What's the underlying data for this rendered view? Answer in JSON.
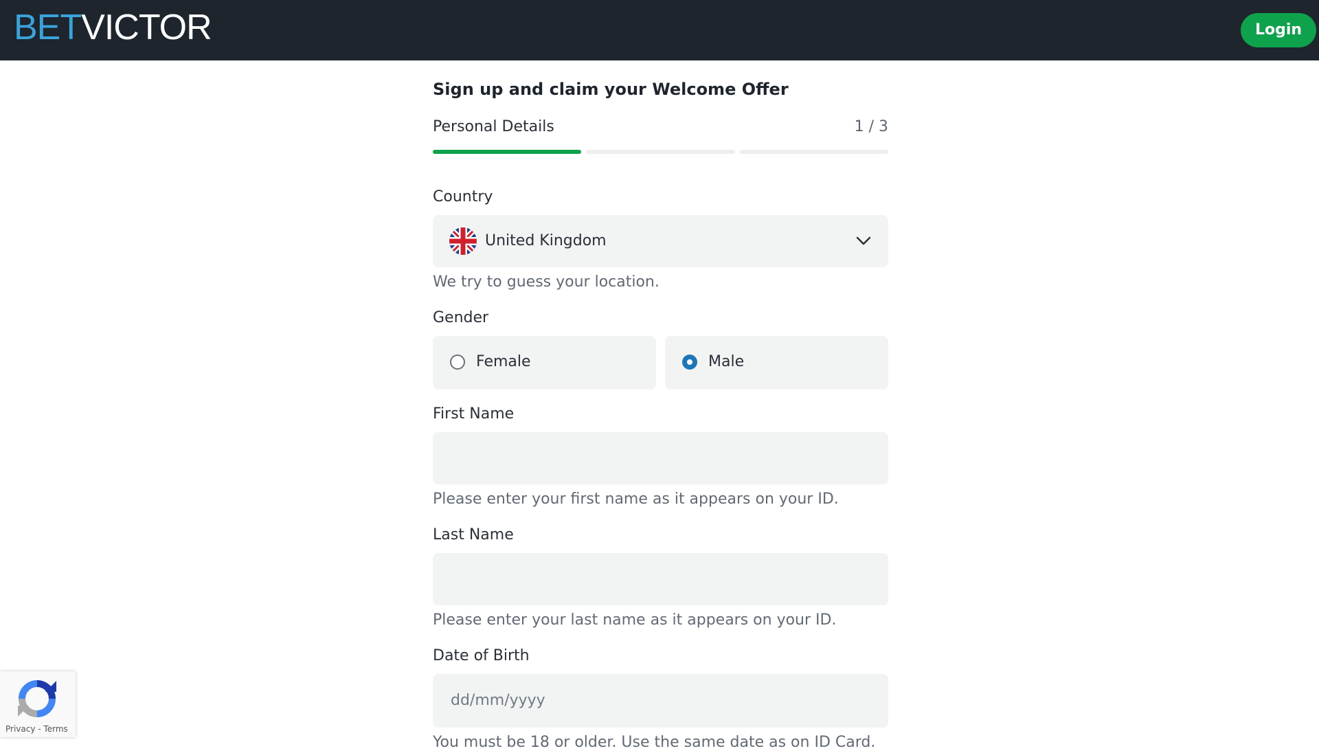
{
  "header": {
    "logo_bet": "BET",
    "logo_victor": "VICTOR",
    "login_label": "Login"
  },
  "form": {
    "title": "Sign up and claim your Welcome Offer",
    "step_name": "Personal Details",
    "step_count": "1 / 3",
    "progress": {
      "current_step": 1,
      "total_steps": 3
    },
    "country": {
      "label": "Country",
      "value": "United Kingdom",
      "flag_icon": "uk-flag-icon",
      "hint": "We try to guess your location."
    },
    "gender": {
      "label": "Gender",
      "options": [
        {
          "label": "Female",
          "checked": false
        },
        {
          "label": "Male",
          "checked": true
        }
      ]
    },
    "first_name": {
      "label": "First Name",
      "value": "",
      "hint": "Please enter your first name as it appears on your ID."
    },
    "last_name": {
      "label": "Last Name",
      "value": "",
      "hint": "Please enter your last name as it appears on your ID."
    },
    "dob": {
      "label": "Date of Birth",
      "placeholder": "dd/mm/yyyy",
      "hint": "You must be 18 or older. Use the same date as on ID Card."
    }
  },
  "recaptcha": {
    "privacy": "Privacy",
    "separator": " - ",
    "terms": "Terms"
  },
  "colors": {
    "header_bg": "#1e252d",
    "brand_blue": "#3aa3dc",
    "accent_green": "#0ea24c",
    "radio_blue": "#1d76b8",
    "field_bg": "#f2f3f3"
  }
}
